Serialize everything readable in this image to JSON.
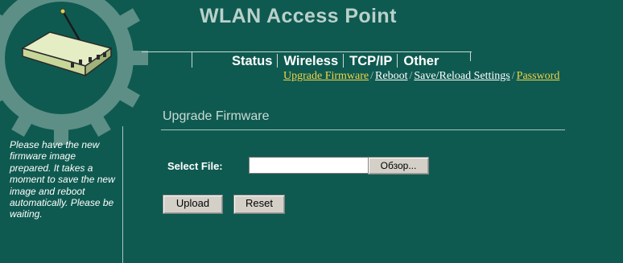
{
  "header": {
    "title": "WLAN Access Point",
    "logo_icon": "router-icon",
    "decor_icon": "gear-icon"
  },
  "nav": {
    "tabs": [
      "Status",
      "Wireless",
      "TCP/IP",
      "Other"
    ],
    "sublinks": [
      {
        "label": "Upgrade Firmware",
        "active": true
      },
      {
        "label": "Reboot",
        "active": false
      },
      {
        "label": "Save/Reload Settings",
        "active": false
      },
      {
        "label": "Password",
        "active": true
      }
    ]
  },
  "sidebar": {
    "help_text": "Please have the new firmware image prepared. It takes a moment to save the new image and reboot automatically. Please be waiting."
  },
  "main": {
    "section_title": "Upgrade Firmware",
    "select_file_label": "Select File:",
    "file_value": "",
    "browse_label": "Обзор...",
    "upload_label": "Upload",
    "reset_label": "Reset"
  },
  "colors": {
    "background": "#0f5a50",
    "gear": "#5d8f86",
    "active_link": "#f0d54a",
    "title": "#b9d1cb"
  }
}
